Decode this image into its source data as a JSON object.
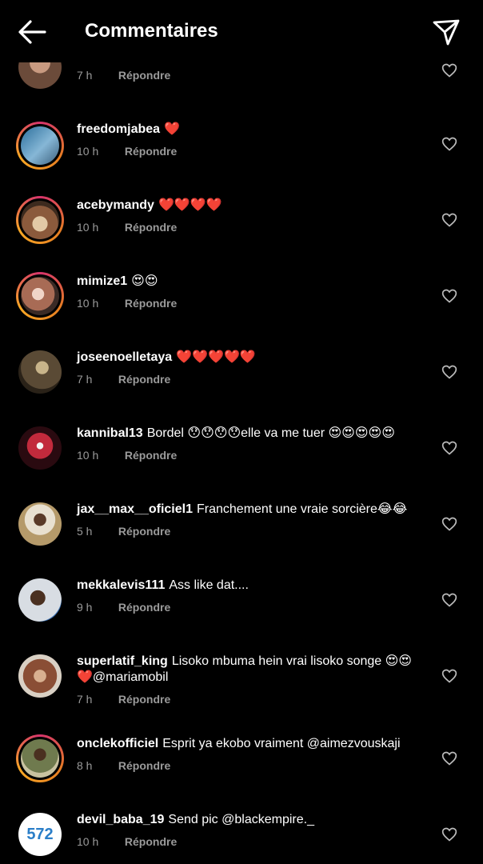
{
  "header": {
    "title": "Commentaires",
    "back_icon": "arrow-left-icon",
    "send_icon": "paper-plane-icon"
  },
  "reply_label": "Répondre",
  "comments": [
    {
      "username": "",
      "text": "",
      "time": "7 h",
      "avatar_color": "#6b4b3a",
      "ring": false
    },
    {
      "username": "freedomjabea",
      "text": "❤️",
      "time": "10 h",
      "avatar_color": "#4a7fa8",
      "ring": true
    },
    {
      "username": "acebymandy",
      "text": "❤️❤️❤️❤️",
      "time": "10 h",
      "avatar_color": "#8b5a3c",
      "ring": true
    },
    {
      "username": "mimize1",
      "text": "😍😍",
      "time": "10 h",
      "avatar_color": "#a86b55",
      "ring": true
    },
    {
      "username": "joseenoelletaya",
      "text": "❤️❤️❤️❤️❤️",
      "time": "7 h",
      "avatar_color": "#5a4a35",
      "ring": false
    },
    {
      "username": "kannibal13",
      "text": "Bordel 😯😯😯😯elle va me tuer 😍😍😍😍😍",
      "time": "10 h",
      "avatar_color": "#7a1f2b",
      "ring": false
    },
    {
      "username": "jax__max__oficiel1",
      "text": "Franchement une vraie sorcière😂😂",
      "time": "5 h",
      "avatar_color": "#b59a6a",
      "ring": false
    },
    {
      "username": "mekkalevis111",
      "text": "Ass like dat....",
      "time": "9 h",
      "avatar_color": "#d8dde3",
      "ring": false
    },
    {
      "username": "superlatif_king",
      "text": "Lisoko mbuma hein vrai lisoko songe 😍😍 ❤️@mariamobil",
      "time": "7 h",
      "avatar_color": "#8a4e35",
      "ring": false
    },
    {
      "username": "onclekofficiel",
      "text": "Esprit ya ekobo vraiment @aimezvouskaji",
      "time": "8 h",
      "avatar_color": "#6f7a4e",
      "ring": true
    },
    {
      "username": "devil_baba_19",
      "text": "Send pic @blackempire._",
      "time": "10 h",
      "avatar_color": "#ffffff",
      "avatar_label": "572",
      "ring": false
    }
  ]
}
